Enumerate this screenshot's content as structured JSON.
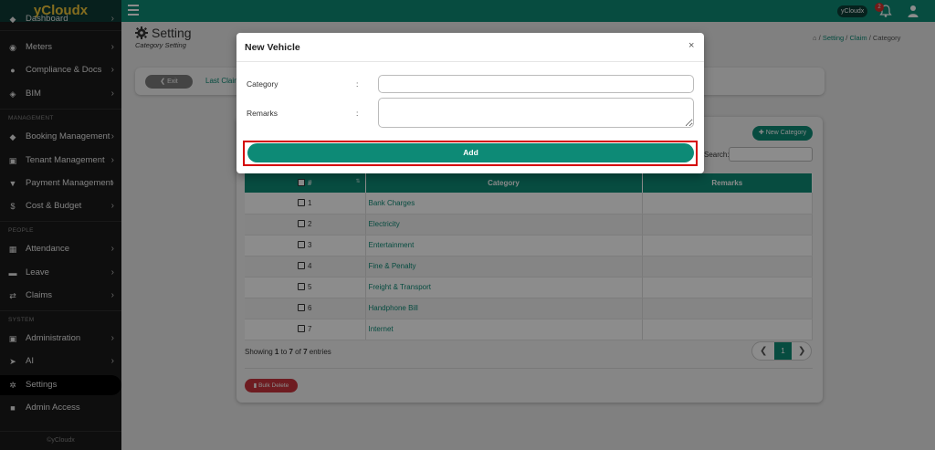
{
  "app": {
    "brand": "yCloudx",
    "user": "yCloudx",
    "notifications": "2"
  },
  "sidebar": {
    "top_partial": "Dashboard",
    "items": [
      {
        "label": "Meters",
        "icon": "dashboard-icon"
      },
      {
        "label": "Compliance & Docs",
        "icon": "circle-icon"
      },
      {
        "label": "BIM",
        "icon": "cube-icon"
      },
      {
        "label": "Booking Management",
        "icon": "tag-icon"
      },
      {
        "label": "Tenant Management",
        "icon": "building-icon"
      },
      {
        "label": "Payment Management",
        "icon": "cart-icon"
      },
      {
        "label": "Cost & Budget",
        "icon": "dollar-icon"
      },
      {
        "label": "Attendance",
        "icon": "calendar-icon"
      },
      {
        "label": "Leave",
        "icon": "briefcase-icon"
      },
      {
        "label": "Claims",
        "icon": "exchange-icon"
      },
      {
        "label": "Administration",
        "icon": "person-card-icon"
      },
      {
        "label": "AI",
        "icon": "paper-plane-icon"
      },
      {
        "label": "Settings",
        "icon": "gear-icon"
      },
      {
        "label": "Admin Access",
        "icon": "lock-icon"
      }
    ],
    "sections": {
      "management": "MANAGEMENT",
      "people": "PEOPLE",
      "system": "SYSTEM"
    },
    "footer": "©yCloudx"
  },
  "page": {
    "title": "Setting",
    "subtitle": "Category Setting",
    "breadcrumb": {
      "setting": "Setting",
      "claim": "Claim",
      "current": "Category",
      "sep": "/"
    },
    "exit_label": "Exit",
    "last_claim": "Last Claim"
  },
  "list": {
    "new_button": "New Category",
    "search_label": "Search:",
    "columns": {
      "num": "#",
      "category": "Category",
      "remarks": "Remarks"
    },
    "rows": [
      {
        "num": "1",
        "category": "Bank Charges",
        "remarks": ""
      },
      {
        "num": "2",
        "category": "Electricity",
        "remarks": ""
      },
      {
        "num": "3",
        "category": "Entertainment",
        "remarks": ""
      },
      {
        "num": "4",
        "category": "Fine & Penalty",
        "remarks": ""
      },
      {
        "num": "5",
        "category": "Freight & Transport",
        "remarks": ""
      },
      {
        "num": "6",
        "category": "Handphone Bill",
        "remarks": ""
      },
      {
        "num": "7",
        "category": "Internet",
        "remarks": ""
      }
    ],
    "showing": {
      "prefix": "Showing ",
      "from": "1",
      "to_word": " to ",
      "to": "7",
      "of_word": " of ",
      "total": "7",
      "suffix": " entries"
    },
    "current_page": "1",
    "bulk_delete": "Bulk Delete"
  },
  "modal": {
    "title": "New Vehicle",
    "close": "×",
    "category_label": "Category",
    "remarks_label": "Remarks",
    "colon": ":",
    "category_value": "",
    "remarks_value": "",
    "add_label": "Add"
  },
  "colors": {
    "primary": "#0d8a76",
    "brand_bg": "#0d3b35",
    "brand_text": "#f0c63a",
    "danger": "#c8343c",
    "highlight": "#d40000"
  }
}
